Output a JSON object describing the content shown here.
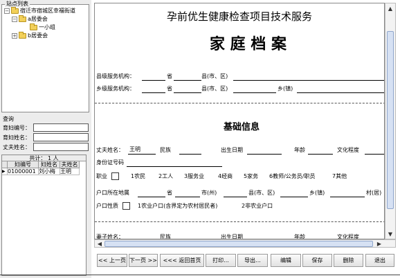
{
  "left": {
    "tree_title": "站点列表",
    "tree": [
      {
        "label": "宿迁市宿城区幸福街道",
        "expander": "−"
      },
      {
        "label": "a居委会",
        "expander": "−"
      },
      {
        "label": "一小组",
        "expander": ""
      },
      {
        "label": "b居委会",
        "expander": "+"
      }
    ],
    "query": {
      "title": "查询",
      "fields": [
        {
          "label": "育妇编号：",
          "value": ""
        },
        {
          "label": "育妇姓名：",
          "value": ""
        },
        {
          "label": "丈夫姓名：",
          "value": ""
        }
      ]
    },
    "grid": {
      "count": "共计： 1 人",
      "columns": [
        "妇编号",
        "妇姓名",
        "夫姓名"
      ],
      "rows": [
        {
          "marker": "▶",
          "cells": [
            "01000001",
            "刘小梅",
            "王明"
          ]
        }
      ]
    }
  },
  "document": {
    "header": "孕前优生健康检查项目技术服务",
    "title": "家 庭 档 案",
    "county_label": "县级服务机构：",
    "town_label": "乡级服务机构：",
    "sheng": "省",
    "xian": "县(市、区)",
    "xiang": "乡(镇)",
    "section": "基础信息",
    "husband_label": "丈夫姓名：",
    "husband_name": "王明",
    "ethnicity": "民族",
    "birth_date": "出生日期",
    "age": "年龄",
    "education": "文化程度",
    "id_number": "身份证号码",
    "occupation": "职业",
    "occupations": [
      "1农民",
      "2工人",
      "3服务业",
      "4经商",
      "5家务",
      "6教师/公务员/职员",
      "7其他"
    ],
    "hukou_place": "户口所在地属",
    "shi": "市(州)",
    "xian2": "县(市、区)",
    "xiang2": "乡(镇)",
    "cun": "村(居)",
    "hukou_type": "户口性质",
    "hukou_opt1": "1农业户口(含界定为农村居民者)",
    "hukou_opt2": "2非农业户口",
    "wife_label": "妻子姓名：",
    "wife_ethnicity": "民族",
    "wife_birth": "出生日期",
    "wife_age": "年龄",
    "wife_education": "文化程度"
  },
  "buttons": {
    "prev": "<< 上一页",
    "next": "下一页 >>",
    "first": "<<< 返回首页",
    "print": "打印...",
    "export": "导出...",
    "edit": "编辑",
    "save": "保存",
    "delete": "删除",
    "exit": "退出"
  }
}
